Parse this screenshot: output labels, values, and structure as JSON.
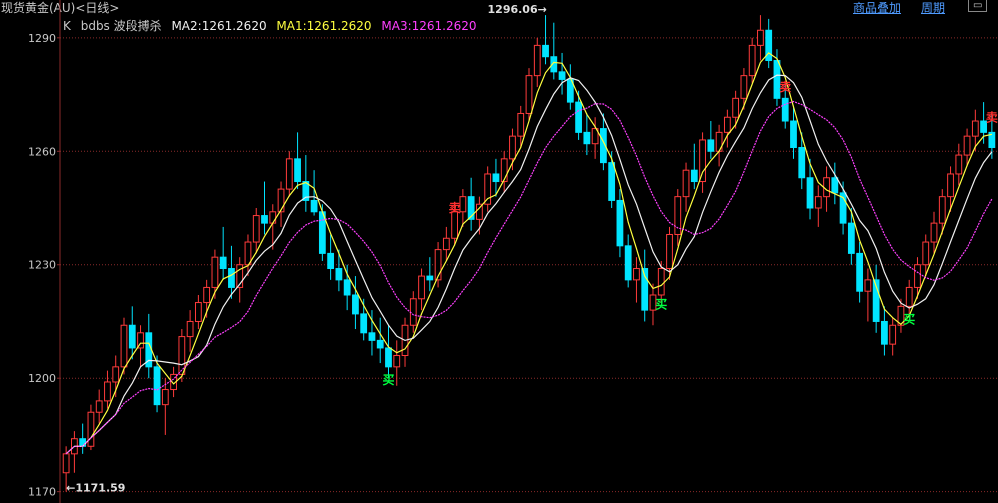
{
  "header": {
    "title": "现货黄金(AU)<日线>",
    "overlay_button": "商品叠加",
    "period_button": "周期",
    "window_button": "▭"
  },
  "legend": {
    "k_label": "K",
    "indicator_name": "bdbs 波段搏杀",
    "ma2": "MA2:1261.2620",
    "ma1": "MA1:1261.2620",
    "ma3": "MA3:1261.2620"
  },
  "colors": {
    "up": "#ff3b3b",
    "down": "#00e4ff",
    "ma1": "#ffff40",
    "ma2": "#f0f0f0",
    "ma3": "#ff40ff",
    "grid": "#8a2a2a",
    "buy": "#00ff40",
    "sell": "#ff3030"
  },
  "chart_data": {
    "type": "candlestick",
    "ylim": [
      1167,
      1300
    ],
    "yticks": [
      1170,
      1200,
      1230,
      1260,
      1290
    ],
    "annotations": {
      "high": "1296.06",
      "low": "1171.59"
    },
    "signals": [
      {
        "type": "buy",
        "label": "买",
        "index": 39
      },
      {
        "type": "sell",
        "label": "卖",
        "index": 47
      },
      {
        "type": "buy",
        "label": "买",
        "index": 72
      },
      {
        "type": "sell",
        "label": "卖",
        "index": 87
      },
      {
        "type": "buy",
        "label": "买",
        "index": 102
      },
      {
        "type": "sell",
        "label": "卖",
        "index": 124
      }
    ],
    "ohlc": [
      [
        1175,
        1182,
        1170,
        1180
      ],
      [
        1180,
        1186,
        1175,
        1184
      ],
      [
        1184,
        1188,
        1180,
        1182
      ],
      [
        1182,
        1193,
        1181,
        1191
      ],
      [
        1191,
        1197,
        1188,
        1194
      ],
      [
        1194,
        1202,
        1192,
        1199
      ],
      [
        1199,
        1206,
        1195,
        1203
      ],
      [
        1203,
        1216,
        1201,
        1214
      ],
      [
        1214,
        1219,
        1205,
        1208
      ],
      [
        1208,
        1214,
        1203,
        1212
      ],
      [
        1212,
        1217,
        1200,
        1203
      ],
      [
        1203,
        1206,
        1191,
        1193
      ],
      [
        1193,
        1200,
        1185,
        1197
      ],
      [
        1197,
        1203,
        1195,
        1201
      ],
      [
        1201,
        1213,
        1199,
        1211
      ],
      [
        1211,
        1218,
        1207,
        1215
      ],
      [
        1215,
        1222,
        1213,
        1220
      ],
      [
        1220,
        1226,
        1216,
        1224
      ],
      [
        1224,
        1234,
        1221,
        1232
      ],
      [
        1232,
        1240,
        1226,
        1229
      ],
      [
        1229,
        1235,
        1221,
        1224
      ],
      [
        1224,
        1232,
        1220,
        1230
      ],
      [
        1230,
        1238,
        1227,
        1236
      ],
      [
        1236,
        1245,
        1233,
        1243
      ],
      [
        1243,
        1252,
        1238,
        1241
      ],
      [
        1241,
        1246,
        1234,
        1244
      ],
      [
        1244,
        1252,
        1240,
        1250
      ],
      [
        1250,
        1260,
        1248,
        1258
      ],
      [
        1258,
        1265,
        1250,
        1252
      ],
      [
        1252,
        1259,
        1244,
        1247
      ],
      [
        1247,
        1255,
        1243,
        1244
      ],
      [
        1244,
        1246,
        1231,
        1233
      ],
      [
        1233,
        1238,
        1226,
        1229
      ],
      [
        1229,
        1234,
        1223,
        1226
      ],
      [
        1226,
        1230,
        1218,
        1222
      ],
      [
        1222,
        1227,
        1213,
        1217
      ],
      [
        1217,
        1221,
        1210,
        1212
      ],
      [
        1212,
        1218,
        1206,
        1210
      ],
      [
        1210,
        1216,
        1204,
        1208
      ],
      [
        1208,
        1214,
        1200,
        1203
      ],
      [
        1203,
        1210,
        1198,
        1206
      ],
      [
        1206,
        1216,
        1203,
        1214
      ],
      [
        1214,
        1223,
        1212,
        1221
      ],
      [
        1221,
        1229,
        1218,
        1227
      ],
      [
        1227,
        1232,
        1223,
        1226
      ],
      [
        1226,
        1236,
        1224,
        1234
      ],
      [
        1234,
        1240,
        1231,
        1237
      ],
      [
        1237,
        1246,
        1235,
        1244
      ],
      [
        1244,
        1250,
        1240,
        1248
      ],
      [
        1248,
        1253,
        1239,
        1242
      ],
      [
        1242,
        1248,
        1238,
        1246
      ],
      [
        1246,
        1256,
        1244,
        1254
      ],
      [
        1254,
        1258,
        1248,
        1252
      ],
      [
        1252,
        1260,
        1249,
        1258
      ],
      [
        1258,
        1266,
        1255,
        1264
      ],
      [
        1264,
        1272,
        1261,
        1270
      ],
      [
        1270,
        1282,
        1268,
        1280
      ],
      [
        1280,
        1290,
        1277,
        1288
      ],
      [
        1288,
        1296,
        1283,
        1285
      ],
      [
        1285,
        1294,
        1279,
        1281
      ],
      [
        1281,
        1286,
        1275,
        1279
      ],
      [
        1279,
        1283,
        1271,
        1273
      ],
      [
        1273,
        1276,
        1263,
        1265
      ],
      [
        1265,
        1270,
        1259,
        1262
      ],
      [
        1262,
        1269,
        1258,
        1266
      ],
      [
        1266,
        1270,
        1255,
        1257
      ],
      [
        1257,
        1260,
        1245,
        1247
      ],
      [
        1247,
        1250,
        1232,
        1235
      ],
      [
        1235,
        1238,
        1224,
        1226
      ],
      [
        1226,
        1232,
        1220,
        1229
      ],
      [
        1229,
        1234,
        1215,
        1218
      ],
      [
        1218,
        1225,
        1214,
        1222
      ],
      [
        1222,
        1231,
        1220,
        1229
      ],
      [
        1229,
        1240,
        1226,
        1238
      ],
      [
        1238,
        1250,
        1235,
        1248
      ],
      [
        1248,
        1257,
        1244,
        1255
      ],
      [
        1255,
        1262,
        1250,
        1252
      ],
      [
        1252,
        1265,
        1249,
        1263
      ],
      [
        1263,
        1268,
        1258,
        1260
      ],
      [
        1260,
        1267,
        1256,
        1265
      ],
      [
        1265,
        1271,
        1261,
        1269
      ],
      [
        1269,
        1276,
        1266,
        1274
      ],
      [
        1274,
        1282,
        1271,
        1280
      ],
      [
        1280,
        1290,
        1278,
        1288
      ],
      [
        1288,
        1296,
        1284,
        1292
      ],
      [
        1292,
        1295,
        1282,
        1284
      ],
      [
        1284,
        1287,
        1272,
        1274
      ],
      [
        1274,
        1278,
        1266,
        1268
      ],
      [
        1268,
        1272,
        1258,
        1261
      ],
      [
        1261,
        1265,
        1250,
        1253
      ],
      [
        1253,
        1258,
        1242,
        1245
      ],
      [
        1245,
        1251,
        1240,
        1248
      ],
      [
        1248,
        1256,
        1244,
        1253
      ],
      [
        1253,
        1257,
        1246,
        1249
      ],
      [
        1249,
        1252,
        1238,
        1241
      ],
      [
        1241,
        1245,
        1230,
        1233
      ],
      [
        1233,
        1236,
        1220,
        1223
      ],
      [
        1223,
        1229,
        1215,
        1226
      ],
      [
        1226,
        1230,
        1212,
        1215
      ],
      [
        1215,
        1219,
        1206,
        1209
      ],
      [
        1209,
        1216,
        1206,
        1214
      ],
      [
        1214,
        1221,
        1212,
        1219
      ],
      [
        1219,
        1226,
        1216,
        1224
      ],
      [
        1224,
        1232,
        1221,
        1230
      ],
      [
        1230,
        1238,
        1227,
        1236
      ],
      [
        1236,
        1244,
        1233,
        1241
      ],
      [
        1241,
        1250,
        1238,
        1248
      ],
      [
        1248,
        1256,
        1244,
        1254
      ],
      [
        1254,
        1262,
        1251,
        1259
      ],
      [
        1259,
        1266,
        1256,
        1264
      ],
      [
        1264,
        1271,
        1260,
        1268
      ],
      [
        1268,
        1273,
        1262,
        1265
      ],
      [
        1265,
        1270,
        1258,
        1261
      ]
    ]
  }
}
